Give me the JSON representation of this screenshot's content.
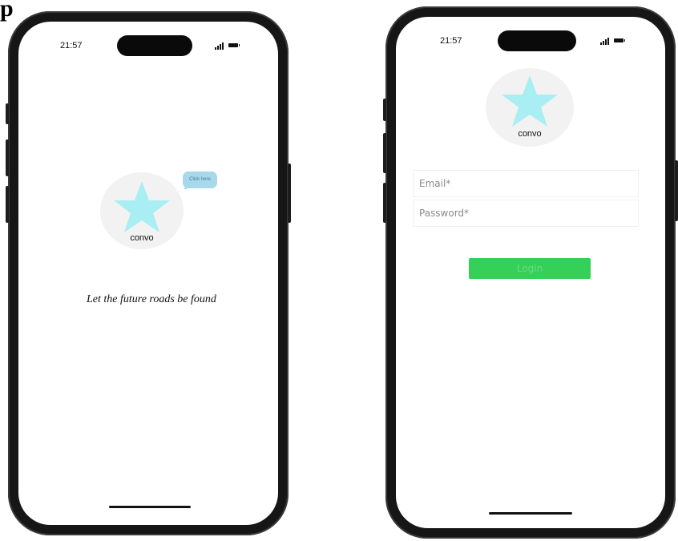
{
  "corner_glyph": "p",
  "splash": {
    "status_time": "21:57",
    "bubble_label": "Click here",
    "logo_label": "convo",
    "tagline": "Let the future roads be found"
  },
  "login": {
    "status_time": "21:57",
    "logo_label": "convo",
    "email_placeholder": "Email*",
    "password_placeholder": "Password*",
    "login_label": "Login"
  },
  "colors": {
    "star": "#a8eef2",
    "logo_bg": "#f2f2f2",
    "bubble": "#a9d8ea",
    "login_button": "#34d058"
  }
}
